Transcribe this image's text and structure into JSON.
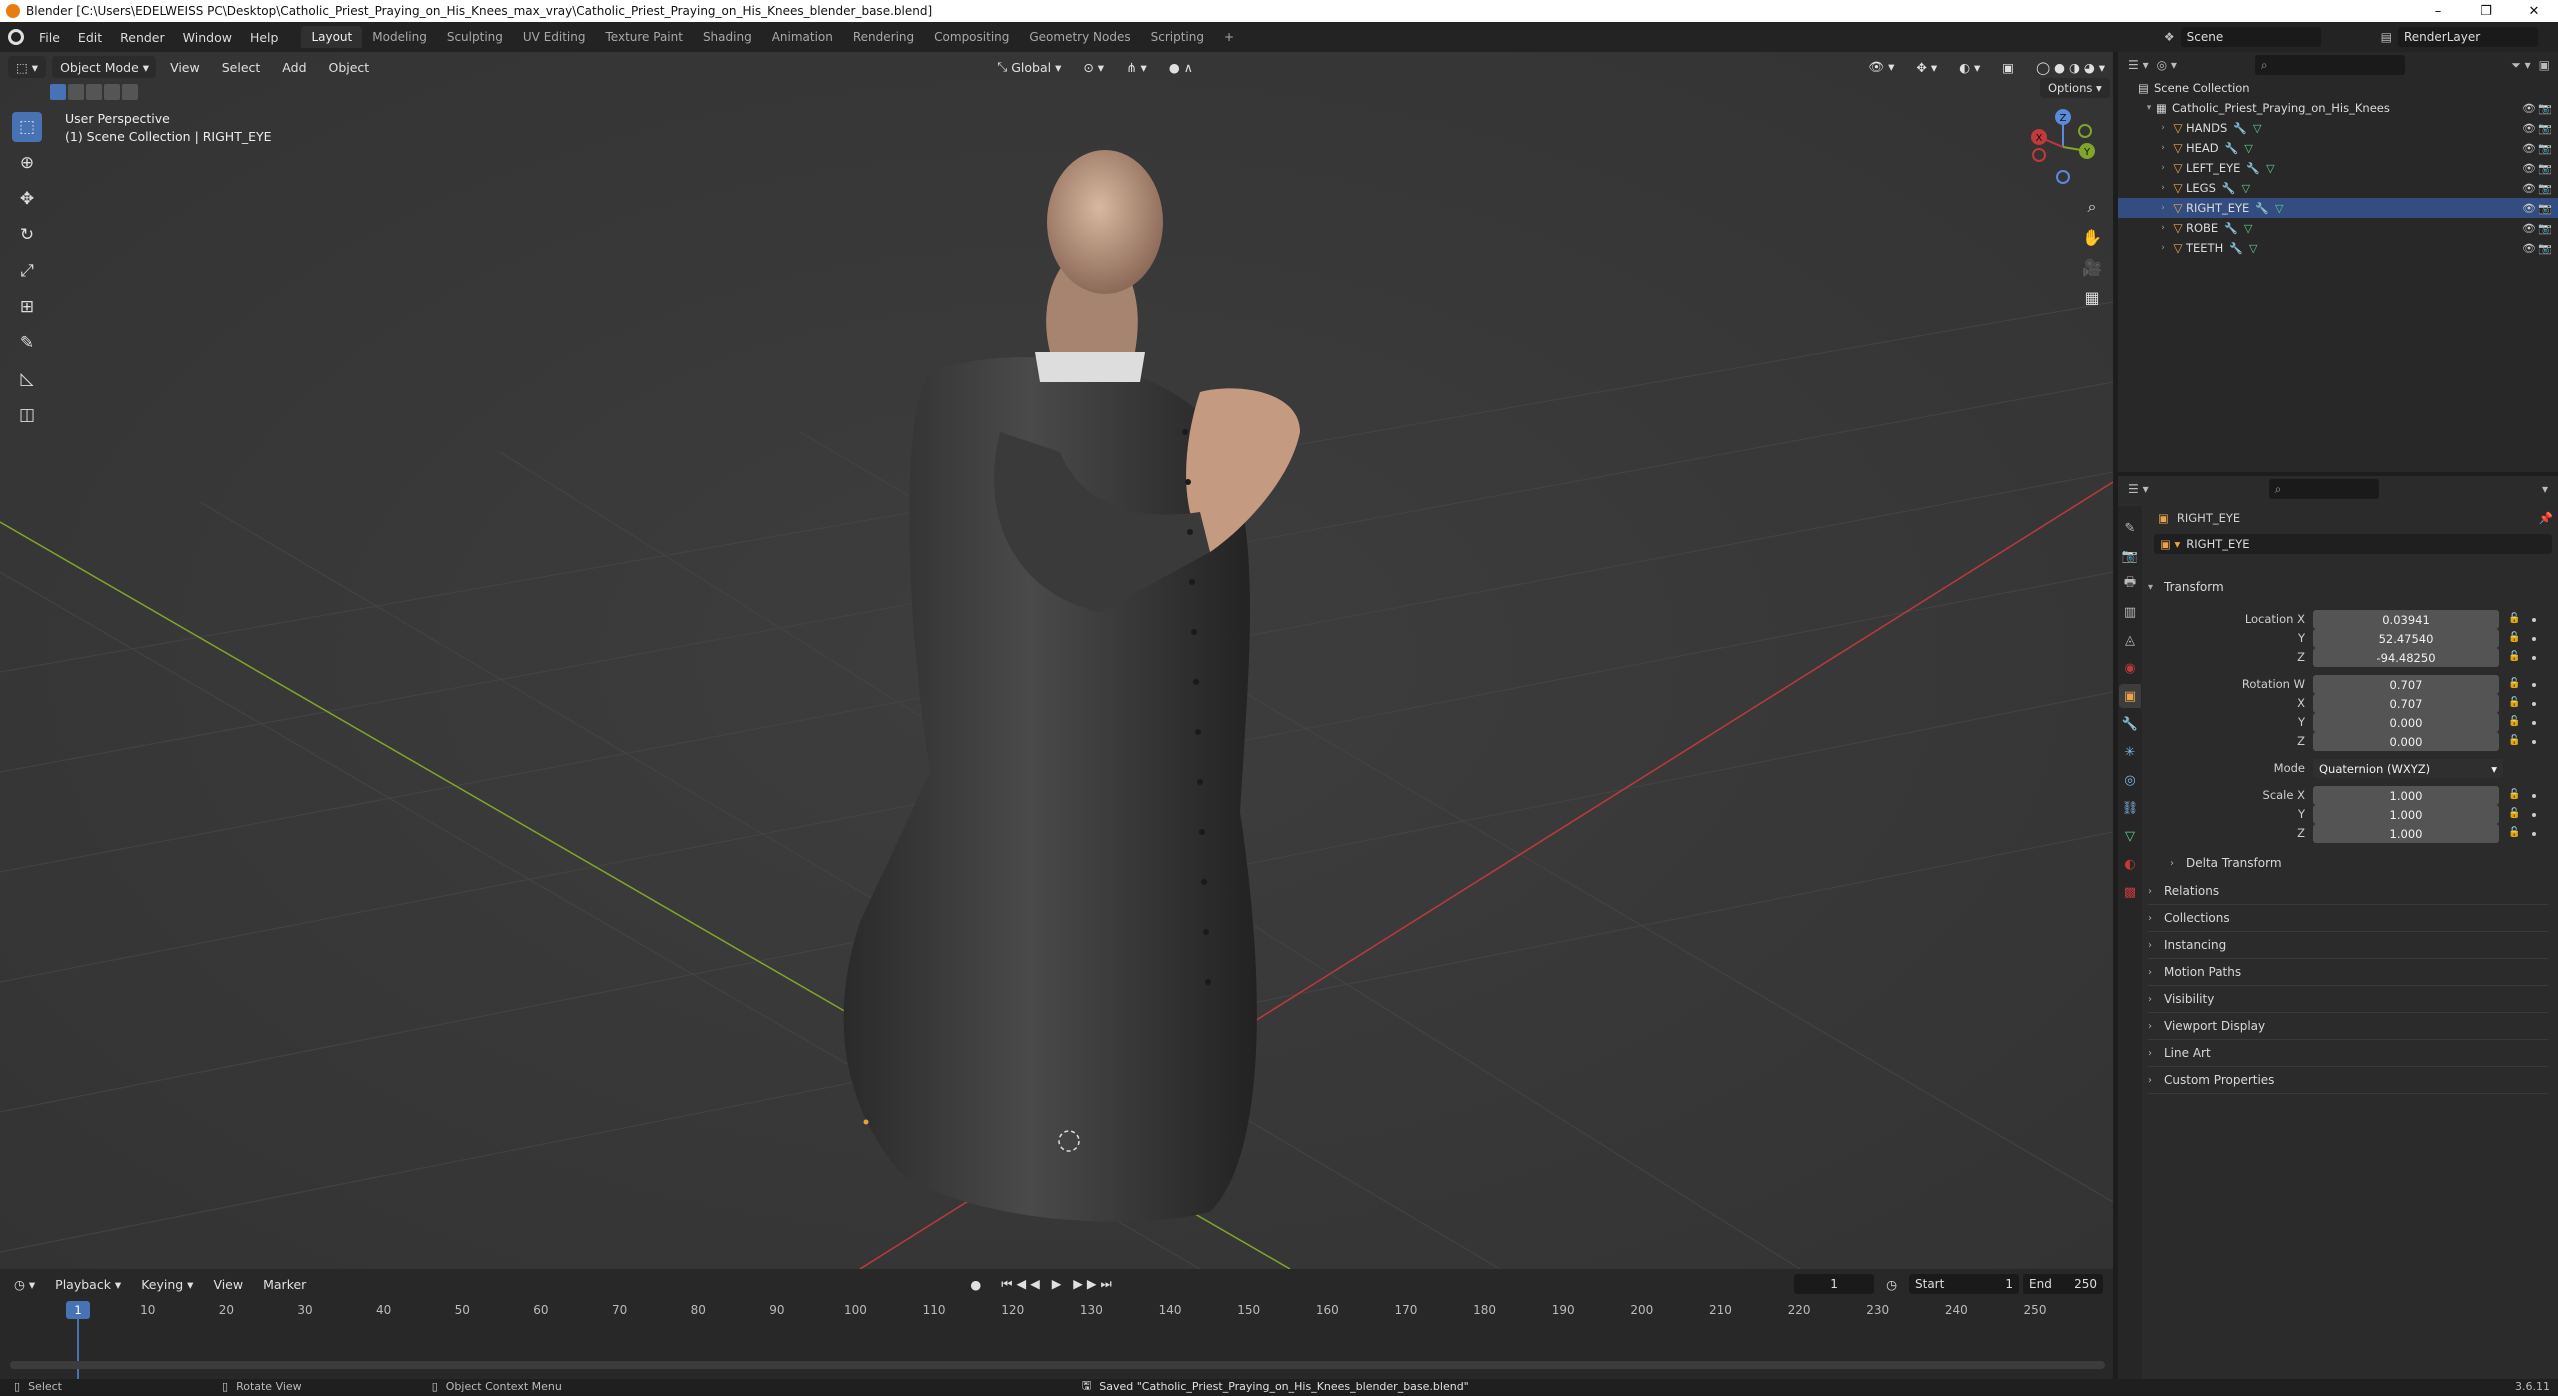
{
  "window": {
    "title": "Blender [C:\\Users\\EDELWEISS PC\\Desktop\\Catholic_Priest_Praying_on_His_Knees_max_vray\\Catholic_Priest_Praying_on_His_Knees_blender_base.blend]",
    "minimize": "–",
    "maximize": "❐",
    "close": "✕"
  },
  "menu": [
    "File",
    "Edit",
    "Render",
    "Window",
    "Help"
  ],
  "workspaces": [
    "Layout",
    "Modeling",
    "Sculpting",
    "UV Editing",
    "Texture Paint",
    "Shading",
    "Animation",
    "Rendering",
    "Compositing",
    "Geometry Nodes",
    "Scripting"
  ],
  "workspace_add": "+",
  "scene": {
    "label": "Scene",
    "view_layer": "RenderLayer"
  },
  "viewport": {
    "mode": "Object Mode",
    "menus": [
      "View",
      "Select",
      "Add",
      "Object"
    ],
    "transform_orientation": "Global",
    "options_label": "Options",
    "info_line1": "User Perspective",
    "info_line2": "(1) Scene Collection | RIGHT_EYE",
    "gizmo": {
      "x": "X",
      "y": "Y",
      "z": "Z"
    },
    "colors": {
      "bg": "#393939",
      "x_axis": "#c0393b",
      "y_axis": "#7fa52b",
      "active_tool": "#4772b3"
    }
  },
  "outliner": {
    "root": "Scene Collection",
    "collection": "Catholic_Priest_Praying_on_His_Knees",
    "objects": [
      "HANDS",
      "HEAD",
      "LEFT_EYE",
      "LEGS",
      "RIGHT_EYE",
      "ROBE",
      "TEETH"
    ],
    "active": "RIGHT_EYE"
  },
  "properties": {
    "object_name": "RIGHT_EYE",
    "data_name": "RIGHT_EYE",
    "transform": {
      "title": "Transform",
      "location_label": "Location X",
      "location": [
        "0.03941",
        "52.47540",
        "-94.48250"
      ],
      "rotation_label": "Rotation W",
      "rotation": [
        "0.707",
        "0.707",
        "0.000",
        "0.000"
      ],
      "mode_label": "Mode",
      "mode": "Quaternion (WXYZ)",
      "scale_label": "Scale X",
      "scale": [
        "1.000",
        "1.000",
        "1.000"
      ],
      "axis_y": "Y",
      "axis_z": "Z",
      "axis_x": "X",
      "delta": "Delta Transform"
    },
    "panels": [
      "Relations",
      "Collections",
      "Instancing",
      "Motion Paths",
      "Visibility",
      "Viewport Display",
      "Line Art",
      "Custom Properties"
    ]
  },
  "timeline": {
    "menus": [
      "Playback",
      "Keying",
      "View",
      "Marker"
    ],
    "current_frame": "1",
    "start_label": "Start",
    "start": "1",
    "end_label": "End",
    "end": "250",
    "ruler": [
      "1",
      "10",
      "20",
      "30",
      "40",
      "50",
      "60",
      "70",
      "80",
      "90",
      "100",
      "110",
      "120",
      "130",
      "140",
      "150",
      "160",
      "170",
      "180",
      "190",
      "200",
      "210",
      "220",
      "230",
      "240",
      "250"
    ]
  },
  "status": {
    "select": "Select",
    "rotate": "Rotate View",
    "context": "Object Context Menu",
    "message": "Saved \"Catholic_Priest_Praying_on_His_Knees_blender_base.blend\"",
    "version": "3.6.11"
  }
}
